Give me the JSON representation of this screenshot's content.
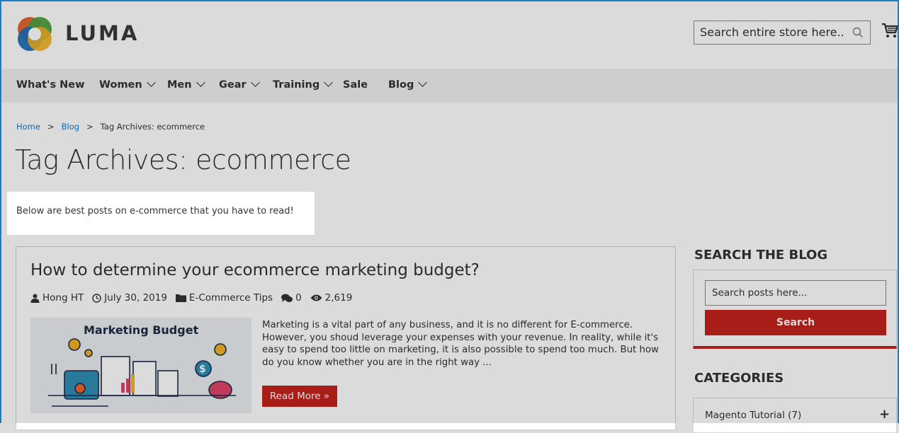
{
  "header": {
    "logo_text": "LUMA",
    "search_placeholder": "Search entire store here..."
  },
  "nav": {
    "items": [
      {
        "label": "What's New",
        "dropdown": false
      },
      {
        "label": "Women",
        "dropdown": true
      },
      {
        "label": "Men",
        "dropdown": true
      },
      {
        "label": "Gear",
        "dropdown": true
      },
      {
        "label": "Training",
        "dropdown": true
      },
      {
        "label": "Sale",
        "dropdown": false
      },
      {
        "label": "Blog",
        "dropdown": true
      }
    ]
  },
  "breadcrumb": {
    "home": "Home",
    "blog": "Blog",
    "current": "Tag Archives: ecommerce",
    "separator": ">"
  },
  "page_title": "Tag Archives: ecommerce",
  "description": "Below are best posts on e-commerce that you have to read!",
  "post": {
    "title": "How to determine your ecommerce marketing budget?",
    "author": "Hong HT",
    "date": "July 30, 2019",
    "category": "E-Commerce Tips",
    "comments": "0",
    "views": "2,619",
    "thumbnail_title": "Marketing Budget",
    "excerpt": "Marketing is a vital part of any business, and it is no different for E-commerce. However, you shoud leverage your expenses with your revenue. In reality, while it's easy to spend too little on marketing, it is also possible to spend too much. But how do you know whether you are in the right way ...",
    "read_more": "Read More »"
  },
  "sidebar": {
    "search_heading": "SEARCH THE BLOG",
    "search_placeholder": "Search posts here...",
    "search_button": "Search",
    "categories_heading": "CATEGORIES",
    "categories": [
      {
        "label": "Magento Tutorial (7)",
        "toggle": "+"
      }
    ]
  },
  "colors": {
    "accent": "#c4221b",
    "link": "#1979c3",
    "frame": "#1c7fc2"
  }
}
